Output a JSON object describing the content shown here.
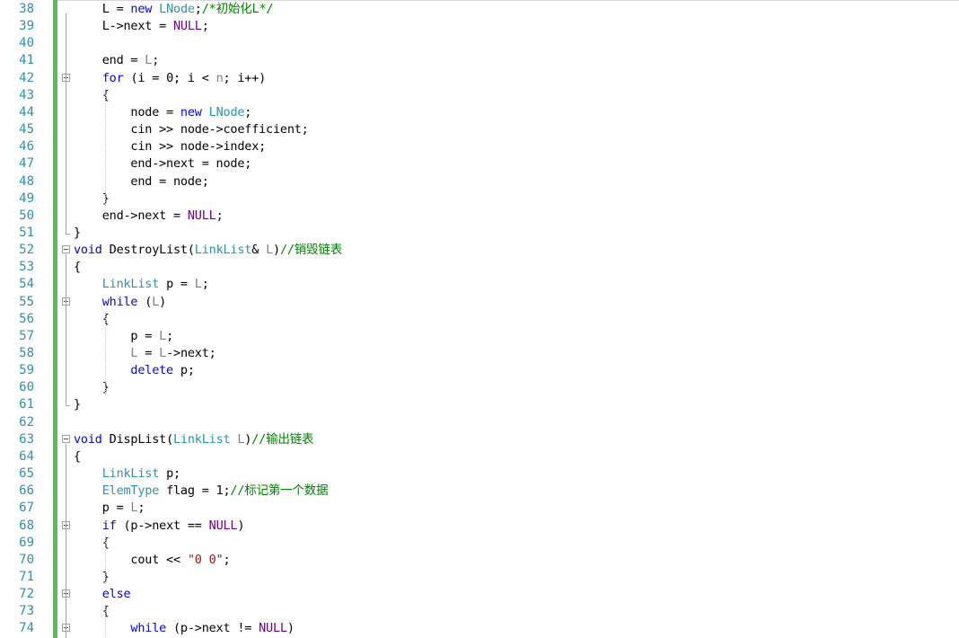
{
  "editor": {
    "lines": [
      {
        "n": "38",
        "fold": false,
        "tokens": [
          [
            "t",
            "    L = "
          ],
          [
            "kw",
            "new"
          ],
          [
            "t",
            " "
          ],
          [
            "ty",
            "LNode"
          ],
          [
            "t",
            ";"
          ],
          [
            "cm",
            "/*初始化L*/"
          ]
        ]
      },
      {
        "n": "39",
        "fold": false,
        "tokens": [
          [
            "t",
            "    L->next = "
          ],
          [
            "mc",
            "NULL"
          ],
          [
            "t",
            ";"
          ]
        ]
      },
      {
        "n": "40",
        "fold": false,
        "tokens": []
      },
      {
        "n": "41",
        "fold": false,
        "tokens": [
          [
            "t",
            "    end = "
          ],
          [
            "pm",
            "L"
          ],
          [
            "t",
            ";"
          ]
        ]
      },
      {
        "n": "42",
        "fold": true,
        "tokens": [
          [
            "t",
            "    "
          ],
          [
            "kw",
            "for"
          ],
          [
            "t",
            " (i = 0; i < "
          ],
          [
            "pm",
            "n"
          ],
          [
            "t",
            "; i++)"
          ]
        ]
      },
      {
        "n": "43",
        "fold": false,
        "tokens": [
          [
            "t",
            "    {"
          ]
        ]
      },
      {
        "n": "44",
        "fold": false,
        "tokens": [
          [
            "t",
            "        node = "
          ],
          [
            "kw",
            "new"
          ],
          [
            "t",
            " "
          ],
          [
            "ty",
            "LNode"
          ],
          [
            "t",
            ";"
          ]
        ]
      },
      {
        "n": "45",
        "fold": false,
        "tokens": [
          [
            "t",
            "        cin >> node->coefficient;"
          ]
        ]
      },
      {
        "n": "46",
        "fold": false,
        "tokens": [
          [
            "t",
            "        cin >> node->index;"
          ]
        ]
      },
      {
        "n": "47",
        "fold": false,
        "tokens": [
          [
            "t",
            "        end->next = node;"
          ]
        ]
      },
      {
        "n": "48",
        "fold": false,
        "tokens": [
          [
            "t",
            "        end = node;"
          ]
        ]
      },
      {
        "n": "49",
        "fold": false,
        "tokens": [
          [
            "t",
            "    }"
          ]
        ]
      },
      {
        "n": "50",
        "fold": false,
        "tokens": [
          [
            "t",
            "    end->next = "
          ],
          [
            "mc",
            "NULL"
          ],
          [
            "t",
            ";"
          ]
        ]
      },
      {
        "n": "51",
        "fold": false,
        "tokens": [
          [
            "t",
            "}"
          ]
        ]
      },
      {
        "n": "52",
        "fold": true,
        "tokens": [
          [
            "kw",
            "void"
          ],
          [
            "t",
            " DestroyList("
          ],
          [
            "ty",
            "LinkList"
          ],
          [
            "t",
            "& "
          ],
          [
            "pm",
            "L"
          ],
          [
            "t",
            ")"
          ],
          [
            "cm",
            "//销毁链表"
          ]
        ]
      },
      {
        "n": "53",
        "fold": false,
        "tokens": [
          [
            "t",
            "{"
          ]
        ]
      },
      {
        "n": "54",
        "fold": false,
        "tokens": [
          [
            "t",
            "    "
          ],
          [
            "ty",
            "LinkList"
          ],
          [
            "t",
            " p = "
          ],
          [
            "pm",
            "L"
          ],
          [
            "t",
            ";"
          ]
        ]
      },
      {
        "n": "55",
        "fold": true,
        "tokens": [
          [
            "t",
            "    "
          ],
          [
            "kw",
            "while"
          ],
          [
            "t",
            " ("
          ],
          [
            "pm",
            "L"
          ],
          [
            "t",
            ")"
          ]
        ]
      },
      {
        "n": "56",
        "fold": false,
        "tokens": [
          [
            "t",
            "    {"
          ]
        ]
      },
      {
        "n": "57",
        "fold": false,
        "tokens": [
          [
            "t",
            "        p = "
          ],
          [
            "pm",
            "L"
          ],
          [
            "t",
            ";"
          ]
        ]
      },
      {
        "n": "58",
        "fold": false,
        "tokens": [
          [
            "t",
            "        "
          ],
          [
            "pm",
            "L"
          ],
          [
            "t",
            " = "
          ],
          [
            "pm",
            "L"
          ],
          [
            "t",
            "->next;"
          ]
        ]
      },
      {
        "n": "59",
        "fold": false,
        "tokens": [
          [
            "t",
            "        "
          ],
          [
            "kw",
            "delete"
          ],
          [
            "t",
            " p;"
          ]
        ]
      },
      {
        "n": "60",
        "fold": false,
        "tokens": [
          [
            "t",
            "    }"
          ]
        ]
      },
      {
        "n": "61",
        "fold": false,
        "tokens": [
          [
            "t",
            "}"
          ]
        ]
      },
      {
        "n": "62",
        "fold": false,
        "tokens": []
      },
      {
        "n": "63",
        "fold": true,
        "tokens": [
          [
            "kw",
            "void"
          ],
          [
            "t",
            " DispList("
          ],
          [
            "ty",
            "LinkList"
          ],
          [
            "t",
            " "
          ],
          [
            "pm",
            "L"
          ],
          [
            "t",
            ")"
          ],
          [
            "cm",
            "//输出链表"
          ]
        ]
      },
      {
        "n": "64",
        "fold": false,
        "tokens": [
          [
            "t",
            "{"
          ]
        ]
      },
      {
        "n": "65",
        "fold": false,
        "tokens": [
          [
            "t",
            "    "
          ],
          [
            "ty",
            "LinkList"
          ],
          [
            "t",
            " p;"
          ]
        ]
      },
      {
        "n": "66",
        "fold": false,
        "tokens": [
          [
            "t",
            "    "
          ],
          [
            "ty",
            "ElemType"
          ],
          [
            "t",
            " flag = 1;"
          ],
          [
            "cm",
            "//标记第一个数据"
          ]
        ]
      },
      {
        "n": "67",
        "fold": false,
        "tokens": [
          [
            "t",
            "    p = "
          ],
          [
            "pm",
            "L"
          ],
          [
            "t",
            ";"
          ]
        ]
      },
      {
        "n": "68",
        "fold": true,
        "tokens": [
          [
            "t",
            "    "
          ],
          [
            "kw",
            "if"
          ],
          [
            "t",
            " (p->next == "
          ],
          [
            "mc",
            "NULL"
          ],
          [
            "t",
            ")"
          ]
        ]
      },
      {
        "n": "69",
        "fold": false,
        "tokens": [
          [
            "t",
            "    {"
          ]
        ]
      },
      {
        "n": "70",
        "fold": false,
        "tokens": [
          [
            "t",
            "        cout << "
          ],
          [
            "st",
            "\"0 0\""
          ],
          [
            "t",
            ";"
          ]
        ]
      },
      {
        "n": "71",
        "fold": false,
        "tokens": [
          [
            "t",
            "    }"
          ]
        ]
      },
      {
        "n": "72",
        "fold": true,
        "tokens": [
          [
            "t",
            "    "
          ],
          [
            "kw",
            "else"
          ]
        ]
      },
      {
        "n": "73",
        "fold": false,
        "tokens": [
          [
            "t",
            "    {"
          ]
        ]
      },
      {
        "n": "74",
        "fold": true,
        "tokens": [
          [
            "t",
            "        "
          ],
          [
            "kw",
            "while"
          ],
          [
            "t",
            " (p->next != "
          ],
          [
            "mc",
            "NULL"
          ],
          [
            "t",
            ")"
          ]
        ]
      }
    ]
  },
  "colors": {
    "line_number": "#2b91af",
    "keyword": "#0000ff",
    "type": "#2b91af",
    "comment": "#008000",
    "string": "#a31515",
    "macro": "#6f008a",
    "parameter": "#808080",
    "change_bar": "#57c157"
  },
  "icons": {
    "fold": "minus-in-box-icon"
  }
}
